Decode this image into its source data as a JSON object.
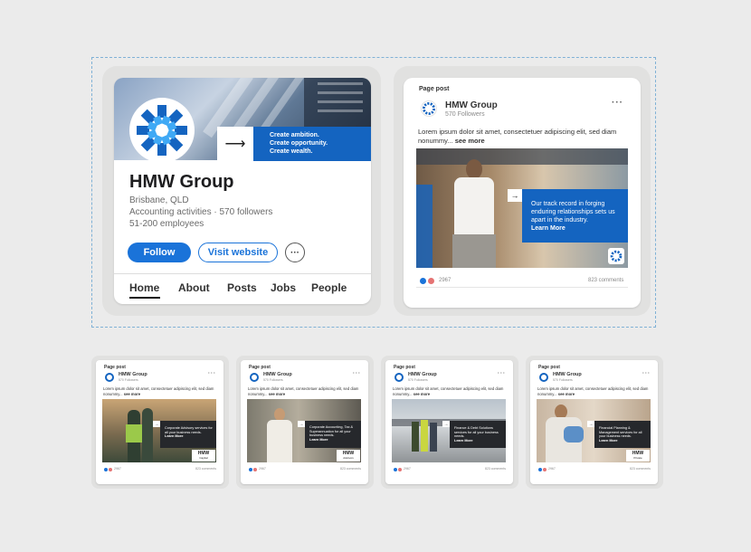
{
  "profile": {
    "company_name": "HMW Group",
    "location": "Brisbane, QLD",
    "industry_followers": "Accounting activities · 570 followers",
    "employees": "51-200 employees",
    "taglines": [
      "Create ambition.",
      "Create opportunity.",
      "Create wealth."
    ],
    "follow_label": "Follow",
    "visit_label": "Visit website",
    "more_label": "···",
    "tabs": [
      "Home",
      "About",
      "Posts",
      "Jobs",
      "People"
    ],
    "active_tab": "Home"
  },
  "main_post": {
    "label": "Page post",
    "company": "HMW Group",
    "followers": "570 Followers",
    "text": "Lorem ipsum dolor sit amet, consectetuer adipiscing elit, sed diam nonummy...",
    "see_more": "see more",
    "overlay_text": "Our track record in forging enduring relationships sets us apart in the industry.",
    "learn_more": "Learn More",
    "reactions": "2967",
    "comments": "823 comments",
    "more_label": "···"
  },
  "small_posts": [
    {
      "label": "Page post",
      "company": "HMW Group",
      "followers": "570 Followers",
      "text": "Lorem ipsum dolor sit amet, consectetuer adipiscing elit, sed diam nonummy...",
      "see_more": "see more",
      "overlay_text": "Corporate Advisory services for all your business needs.",
      "learn_more": "Learn More",
      "badge": "HMW",
      "badge_sub": "Capital",
      "reactions": "2967",
      "comments": "823 comments"
    },
    {
      "label": "Page post",
      "company": "HMW Group",
      "followers": "570 Followers",
      "text": "Lorem ipsum dolor sit amet, consectetuer adipiscing elit, sed diam nonummy...",
      "see_more": "see more",
      "overlay_text": "Corporate Accounting, Tax & Superannuation for all your business needs.",
      "learn_more": "Learn More",
      "badge": "HMW",
      "badge_sub": "Advisors",
      "reactions": "2967",
      "comments": "823 comments"
    },
    {
      "label": "Page post",
      "company": "HMW Group",
      "followers": "570 Followers",
      "text": "Lorem ipsum dolor sit amet, consectetuer adipiscing elit, sed diam nonummy...",
      "see_more": "see more",
      "overlay_text": "Finance & Debt Solutions services for all your business needs.",
      "learn_more": "Learn More",
      "badge": "",
      "badge_sub": "",
      "reactions": "2967",
      "comments": "823 comments"
    },
    {
      "label": "Page post",
      "company": "HMW Group",
      "followers": "570 Followers",
      "text": "Lorem ipsum dolor sit amet, consectetuer adipiscing elit, sed diam nonummy...",
      "see_more": "see more",
      "overlay_text": "Financial Planning & Management services for all your business needs.",
      "learn_more": "Learn More",
      "badge": "HMW",
      "badge_sub": "Private",
      "reactions": "2967",
      "comments": "823 comments"
    }
  ],
  "colors": {
    "brand_blue": "#1464c0",
    "button_blue": "#1a73d9",
    "reaction_blue": "#1a73d9",
    "reaction_red": "#e57373",
    "dashed": "#7fb1d6"
  },
  "icons": {
    "logo": "hmw-star-logo",
    "arrow": "right-arrow-icon"
  }
}
